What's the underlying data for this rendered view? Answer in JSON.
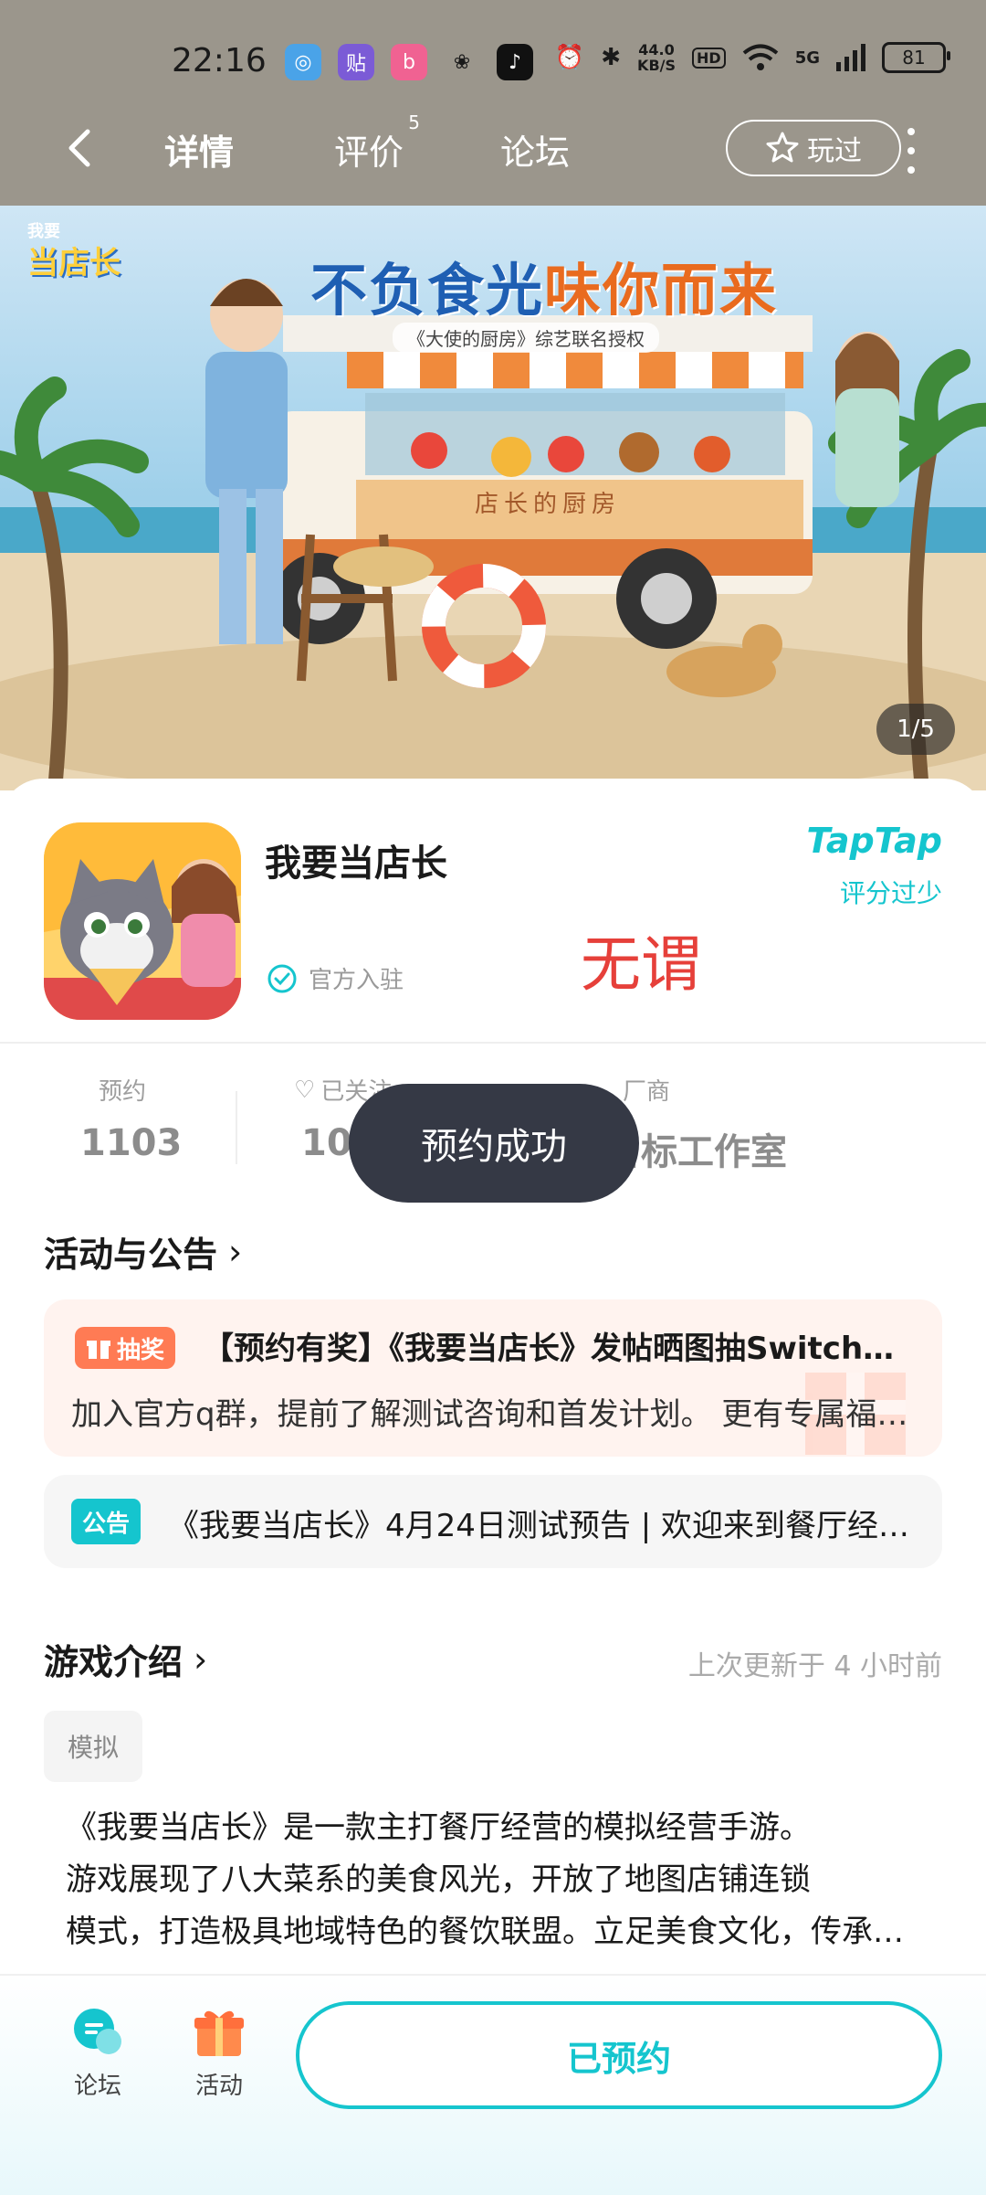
{
  "status_bar": {
    "time": "22:16",
    "net_speed_value": "44.0",
    "net_speed_unit": "KB/S",
    "hd": "HD",
    "signal": "5G",
    "battery": "81"
  },
  "nav": {
    "tabs": [
      {
        "label": "详情"
      },
      {
        "label": "评价",
        "badge": "5"
      },
      {
        "label": "论坛"
      }
    ],
    "played_label": "玩过"
  },
  "banner": {
    "logo_top": "我要",
    "logo_main": "当店长",
    "title_part1": "不负食光",
    "title_part2": "味你而来",
    "subtitle": "《大使的厨房》综艺联名授权",
    "truck_sign": "店长的厨房",
    "page_indicator": "1/5"
  },
  "game": {
    "name": "我要当店长",
    "official_label": "官方入驻",
    "rating_brand": "TapTap",
    "rating_note": "评分过少",
    "watermark": "无谓"
  },
  "stats": [
    {
      "label": "预约",
      "value": "1103"
    },
    {
      "label": "已关注",
      "value": "1073"
    },
    {
      "label": "厂商",
      "value": "小目标工作室"
    }
  ],
  "toast": "预约成功",
  "activities": {
    "title": "活动与公告",
    "lottery": {
      "badge": "抽奖",
      "title": "【预约有奖】《我要当店长》发帖晒图抽Switch、周边等好礼",
      "desc": "加入官方q群，提前了解测试咨询和首发计划。 更有专属福利等你来拿"
    },
    "notice": {
      "badge": "公告",
      "text": "《我要当店长》4月24日测试预告 | 欢迎来到餐厅经营的世界"
    }
  },
  "intro": {
    "title": "游戏介绍",
    "updated": "上次更新于 4 小时前",
    "tag": "模拟",
    "lines": [
      "《我要当店长》是一款主打餐厅经营的模拟经营手游。",
      "游戏展现了八大菜系的美食风光，开放了地图店铺连锁",
      "模式，打造极具地域特色的餐饮联盟。立足美食文化，传承中华美味"
    ]
  },
  "bottom": {
    "forum_label": "论坛",
    "activity_label": "活动",
    "reserved_label": "已预约"
  },
  "colors": {
    "accent": "#15c5ce",
    "header_bg": "#9b968c",
    "toast_bg": "#353945",
    "lottery_badge": "#ff7b54",
    "watermark": "#e6403a"
  }
}
